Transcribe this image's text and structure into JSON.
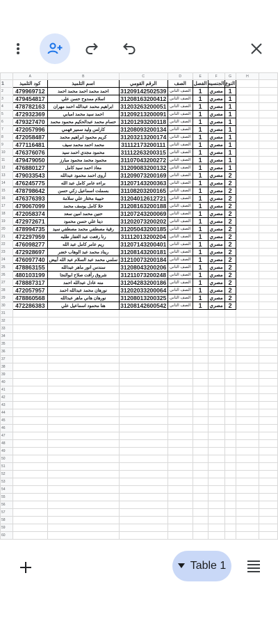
{
  "toolbar": {
    "more_icon": "more-vert-icon",
    "share_icon": "add-person-icon",
    "redo_icon": "redo-icon",
    "undo_icon": "undo-icon",
    "close_icon": "close-icon"
  },
  "columns": [
    "A",
    "B",
    "C",
    "D",
    "E",
    "F",
    "G",
    "H"
  ],
  "header": {
    "code": "كود التلميذ",
    "name": "اسم التلميذ",
    "nid": "الرقم القومي",
    "grade": "الصف",
    "cls": "الفصل",
    "nat": "الجنسيه",
    "typ": "النوع"
  },
  "rows": [
    {
      "code": "479969712",
      "name": "احمد محمد احمد محمد احمد",
      "nid": "31209142502539",
      "grade": "الصف الثاني",
      "cls": "1",
      "nat": "مصري",
      "typ": "1"
    },
    {
      "code": "479454817",
      "name": "اسلام ممدوح حسن علي",
      "nid": "31208163200412",
      "grade": "الصف الثاني",
      "cls": "1",
      "nat": "مصري",
      "typ": "1"
    },
    {
      "code": "478782163",
      "name": "ابراهيم محمد عبدالله احمد مهران",
      "nid": "31203263200051",
      "grade": "الصف الثاني",
      "cls": "1",
      "nat": "مصري",
      "typ": "1"
    },
    {
      "code": "472932369",
      "name": "احمد سيد محمد امبابي",
      "nid": "31209213200091",
      "grade": "الصف الثاني",
      "cls": "1",
      "nat": "مصري",
      "typ": "1"
    },
    {
      "code": "479327470",
      "name": "حسام محمد عبدالحكيم محمود محمد",
      "nid": "31201293200118",
      "grade": "الصف الثاني",
      "cls": "1",
      "nat": "مصري",
      "typ": "1"
    },
    {
      "code": "472057996",
      "name": "كارلس وليد سمير فهمي",
      "nid": "31208093200134",
      "grade": "الصف الثاني",
      "cls": "1",
      "nat": "مصري",
      "typ": "1"
    },
    {
      "code": "472058487",
      "name": "كريم محمود ابراهيم محمد",
      "nid": "31203213200174",
      "grade": "الصف الثاني",
      "cls": "1",
      "nat": "مصري",
      "typ": "1"
    },
    {
      "code": "477116481",
      "name": "محمد احمد محمد سيف",
      "nid": "31112173200111",
      "grade": "الصف الثاني",
      "cls": "1",
      "nat": "مصري",
      "typ": "1"
    },
    {
      "code": "476376076",
      "name": "محمود مجدي احمد سيد",
      "nid": "31112263200315",
      "grade": "الصف الثاني",
      "cls": "1",
      "nat": "مصري",
      "typ": "1"
    },
    {
      "code": "479479050",
      "name": "محمود محمد محمود مبارز",
      "nid": "31107043200272",
      "grade": "الصف الثاني",
      "cls": "1",
      "nat": "مصري",
      "typ": "1"
    },
    {
      "code": "476880127",
      "name": "معاذ احمد سيد كامل",
      "nid": "31209083200132",
      "grade": "الصف الثاني",
      "cls": "1",
      "nat": "مصري",
      "typ": "1"
    },
    {
      "code": "479033543",
      "name": "أروى احمد محمود عبدالله",
      "nid": "31209073200169",
      "grade": "الصف الثاني",
      "cls": "1",
      "nat": "مصري",
      "typ": "2"
    },
    {
      "code": "476245775",
      "name": "براءه عامر كامل عبد الله",
      "nid": "31207143200363",
      "grade": "الصف الثاني",
      "cls": "1",
      "nat": "مصري",
      "typ": "2"
    },
    {
      "code": "478798642",
      "name": "بسملت اسماعيل زكي حسن",
      "nid": "31108203200165",
      "grade": "الصف الثاني",
      "cls": "1",
      "nat": "مصري",
      "typ": "2"
    },
    {
      "code": "476376393",
      "name": "حبيبة مختار علي سلامة",
      "nid": "31204012612721",
      "grade": "الصف الثاني",
      "cls": "1",
      "nat": "مصري",
      "typ": "2"
    },
    {
      "code": "479067099",
      "name": "حلا كامل يوسف محمد",
      "nid": "31208163200188",
      "grade": "الصف الثاني",
      "cls": "1",
      "nat": "مصري",
      "typ": "2"
    },
    {
      "code": "472058374",
      "name": "حنين محمد امين سعد",
      "nid": "31207243200069",
      "grade": "الصف الثاني",
      "cls": "1",
      "nat": "مصري",
      "typ": "2"
    },
    {
      "code": "472972671",
      "name": "دينا علي حسن محمود",
      "nid": "31202073200202",
      "grade": "الصف الثاني",
      "cls": "1",
      "nat": "مصري",
      "typ": "2"
    },
    {
      "code": "478994735",
      "name": "رقية مصطفي محمد مصطفي سيد",
      "nid": "31205043200185",
      "grade": "الصف الثاني",
      "cls": "1",
      "nat": "مصري",
      "typ": "2"
    },
    {
      "code": "472297959",
      "name": "رنا رفعت عبد الغفار طلبه",
      "nid": "31112013200204",
      "grade": "الصف الثاني",
      "cls": "1",
      "nat": "مصري",
      "typ": "2"
    },
    {
      "code": "476098277",
      "name": "ريم عامر كامل عبد الله",
      "nid": "31207143200401",
      "grade": "الصف الثاني",
      "cls": "1",
      "nat": "مصري",
      "typ": "2"
    },
    {
      "code": "472928697",
      "name": "ريناد محمد عبد الوهاب خضر",
      "nid": "31208143200181",
      "grade": "الصف الثاني",
      "cls": "1",
      "nat": "مصري",
      "typ": "2"
    },
    {
      "code": "476097740",
      "name": "سلمي محمد عبد السلام عبد الله أبيض",
      "nid": "31210073200184",
      "grade": "الصف الثاني",
      "cls": "1",
      "nat": "مصري",
      "typ": "2"
    },
    {
      "code": "478863155",
      "name": "سندس انور ماهر عبدالله",
      "nid": "31208043200206",
      "grade": "الصف الثاني",
      "cls": "1",
      "nat": "مصري",
      "typ": "2"
    },
    {
      "code": "480103199",
      "name": "شروق رأفت صلاح ابوالنجا",
      "nid": "31211073200248",
      "grade": "الصف الثاني",
      "cls": "1",
      "nat": "مصري",
      "typ": "2"
    },
    {
      "code": "478887317",
      "name": "منه عادل عبدالله احمد",
      "nid": "31204283200186",
      "grade": "الصف الثاني",
      "cls": "1",
      "nat": "مصري",
      "typ": "2"
    },
    {
      "code": "472057957",
      "name": "نورهان محمد عبدالله احمد",
      "nid": "31202033200064",
      "grade": "الصف الثاني",
      "cls": "1",
      "nat": "مصري",
      "typ": "2"
    },
    {
      "code": "478860568",
      "name": "نورهان هاني ماهر عبدالله",
      "nid": "31208013200325",
      "grade": "الصف الثاني",
      "cls": "1",
      "nat": "مصري",
      "typ": "2"
    },
    {
      "code": "472286383",
      "name": "هنا محمود اسماعيل علي",
      "nid": "31208142600542",
      "grade": "الصف الثاني",
      "cls": "1",
      "nat": "مصري",
      "typ": "2"
    }
  ],
  "total_rows": 60,
  "bottom": {
    "add_icon": "add-icon",
    "table_label": "Table 1",
    "dropdown_icon": "dropdown-triangle-icon",
    "menu_icon": "menu-lines-icon"
  }
}
